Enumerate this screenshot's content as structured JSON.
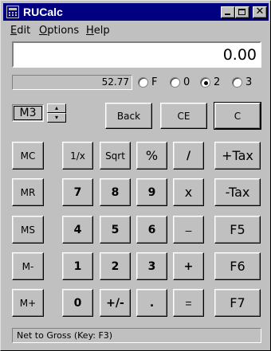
{
  "window": {
    "title": "RUCalc",
    "controls": {
      "minimize_icon": "minimize-icon",
      "maximize_icon": "maximize-icon",
      "close_icon": "close-icon",
      "close_glyph": "✕"
    }
  },
  "menu": [
    {
      "accel": "E",
      "rest": "dit"
    },
    {
      "accel": "O",
      "rest": "ptions"
    },
    {
      "accel": "H",
      "rest": "elp"
    }
  ],
  "display": {
    "value": "0.00"
  },
  "memory": {
    "value": "52.77"
  },
  "decimals": {
    "options": [
      "F",
      "0",
      "2",
      "3"
    ],
    "selected": "2"
  },
  "memory_slot": {
    "value": "M3",
    "up_glyph": "▴",
    "down_glyph": "▾"
  },
  "buttons": {
    "back": "Back",
    "ce": "CE",
    "c": "C",
    "mc": "MC",
    "mr": "MR",
    "ms": "MS",
    "mminus": "M-",
    "mplus": "M+",
    "inv": "1/x",
    "sqrt": "Sqrt",
    "percent": "%",
    "divide": "/",
    "seven": "7",
    "eight": "8",
    "nine": "9",
    "multiply": "x",
    "four": "4",
    "five": "5",
    "six": "6",
    "subtract": "–",
    "one": "1",
    "two": "2",
    "three": "3",
    "add": "+",
    "zero": "0",
    "sign": "+/-",
    "point": ".",
    "equals": "=",
    "plus_tax": "+Tax",
    "minus_tax": "-Tax",
    "f5": "F5",
    "f6": "F6",
    "f7": "F7"
  },
  "status": {
    "text": "Net to Gross  (Key: F3)"
  }
}
